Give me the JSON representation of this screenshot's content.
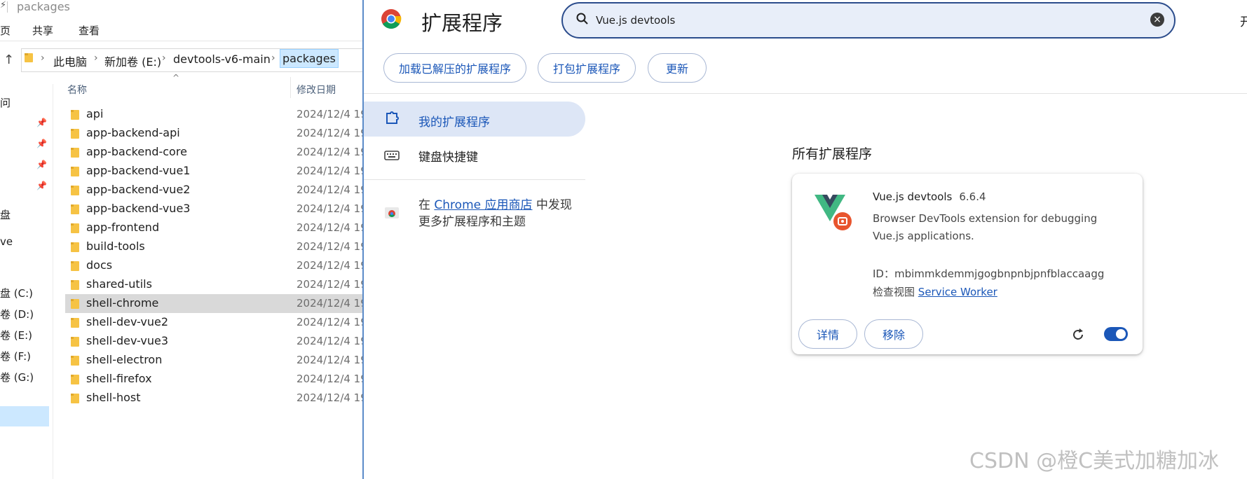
{
  "explorer": {
    "title": "packages",
    "ribbon_tabs": [
      "页",
      "共享",
      "查看"
    ],
    "breadcrumbs": [
      "此电脑",
      "新加卷 (E:)",
      "devtools-v6-main",
      "packages"
    ],
    "nav_items": [
      "问",
      "盘",
      "ve",
      "盘 (C:)",
      "卷 (D:)",
      "卷 (E:)",
      "卷 (F:)",
      "卷 (G:)"
    ],
    "columns": {
      "name": "名称",
      "date": "修改日期"
    },
    "folders": [
      {
        "name": "api",
        "date": "2024/12/4 19"
      },
      {
        "name": "app-backend-api",
        "date": "2024/12/4 19"
      },
      {
        "name": "app-backend-core",
        "date": "2024/12/4 19"
      },
      {
        "name": "app-backend-vue1",
        "date": "2024/12/4 19"
      },
      {
        "name": "app-backend-vue2",
        "date": "2024/12/4 19"
      },
      {
        "name": "app-backend-vue3",
        "date": "2024/12/4 19"
      },
      {
        "name": "app-frontend",
        "date": "2024/12/4 19"
      },
      {
        "name": "build-tools",
        "date": "2024/12/4 19"
      },
      {
        "name": "docs",
        "date": "2024/12/4 19"
      },
      {
        "name": "shared-utils",
        "date": "2024/12/4 19"
      },
      {
        "name": "shell-chrome",
        "date": "2024/12/4 19"
      },
      {
        "name": "shell-dev-vue2",
        "date": "2024/12/4 19"
      },
      {
        "name": "shell-dev-vue3",
        "date": "2024/12/4 19"
      },
      {
        "name": "shell-electron",
        "date": "2024/12/4 19"
      },
      {
        "name": "shell-firefox",
        "date": "2024/12/4 19"
      },
      {
        "name": "shell-host",
        "date": "2024/12/4 19"
      }
    ],
    "selected_folder": "shell-chrome",
    "selected_drive": "卷 (E:)"
  },
  "chrome": {
    "page_title": "扩展程序",
    "search": {
      "value": "Vue.js devtools"
    },
    "dev_mode_label": "开",
    "toolbar": {
      "load_unpacked": "加载已解压的扩展程序",
      "pack": "打包扩展程序",
      "update": "更新"
    },
    "sidebar": {
      "my_extensions": "我的扩展程序",
      "shortcuts": "键盘快捷键",
      "store_prefix": "在 ",
      "store_link": "Chrome 应用商店",
      "store_suffix": " 中发现",
      "store_line2": "更多扩展程序和主题"
    },
    "section_title": "所有扩展程序",
    "extension": {
      "name": "Vue.js devtools",
      "version": "6.6.4",
      "description": "Browser DevTools extension for debugging Vue.js applications.",
      "id_label": "ID：",
      "id": "mbimmkdemmjgogbnpnbjpnfblaccaagg",
      "inspect_label": "检查视图",
      "inspect_link": "Service Worker",
      "details_button": "详情",
      "remove_button": "移除",
      "enabled": true
    },
    "colors": {
      "accent": "#1b57b8",
      "vue_green": "#41b883",
      "vue_dark": "#35495e",
      "badge_orange": "#e8552e"
    }
  },
  "watermark": "CSDN @橙C美式加糖加冰"
}
